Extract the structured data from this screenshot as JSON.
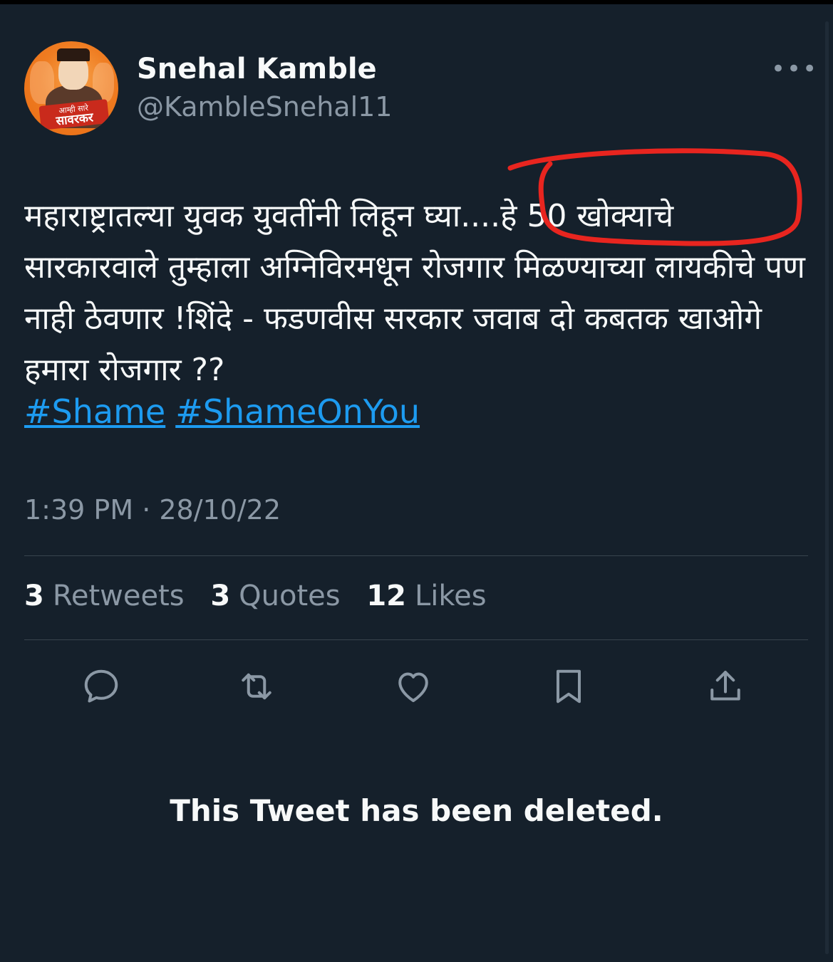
{
  "author": {
    "name": "Snehal Kamble",
    "handle": "@KambleSnehal11",
    "avatar_text_top": "आम्ही सारे",
    "avatar_text_bottom": "सावरकर"
  },
  "more_menu_label": "•••",
  "tweet": {
    "text": "महाराष्ट्रातल्या युवक युवतींनी लिहून घ्या....हे 50 खोक्याचे सारकारवाले तुम्हाला अग्निविरमधून रोजगार मिळण्याच्या लायकीचे पण नाही ठेवणार !शिंदे - फडणवीस सरकार जवाब दो कबतक खाओगे हमारा रोजगार ??",
    "hashtags": [
      "#Shame",
      "#ShameOnYou"
    ],
    "timestamp": "1:39 PM · 28/10/22"
  },
  "stats": [
    {
      "count": "3",
      "label": "Retweets"
    },
    {
      "count": "3",
      "label": "Quotes"
    },
    {
      "count": "12",
      "label": "Likes"
    }
  ],
  "actions": [
    "reply-icon",
    "retweet-icon",
    "like-icon",
    "bookmark-icon",
    "share-icon"
  ],
  "annotation_color": "#e8251f",
  "accent_color": "#1d9bf0",
  "deleted_notice": "This Tweet has been deleted."
}
